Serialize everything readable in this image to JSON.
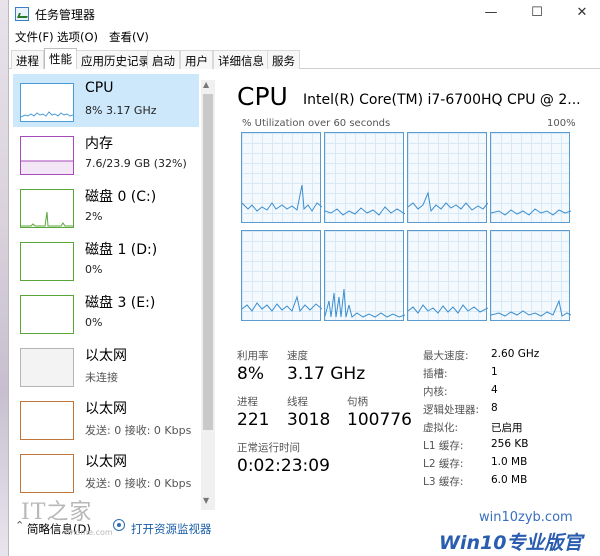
{
  "window": {
    "title": "任务管理器",
    "min": "—",
    "max": "☐",
    "close": "✕"
  },
  "menu": [
    "文件(F)",
    "选项(O)",
    "查看(V)"
  ],
  "tabs": [
    "进程",
    "性能",
    "应用历史记录",
    "启动",
    "用户",
    "详细信息",
    "服务"
  ],
  "active_tab": 1,
  "resources": [
    {
      "name": "CPU",
      "sub": "8% 3.17 GHz",
      "color": "#4a9bd6",
      "selected": true
    },
    {
      "name": "内存",
      "sub": "7.6/23.9 GB (32%)",
      "color": "#a44bb8"
    },
    {
      "name": "磁盘 0 (C:)",
      "sub": "2%",
      "color": "#5aa53a"
    },
    {
      "name": "磁盘 1 (D:)",
      "sub": "0%",
      "color": "#5aa53a"
    },
    {
      "name": "磁盘 3 (E:)",
      "sub": "0%",
      "color": "#5aa53a"
    },
    {
      "name": "以太网",
      "sub": "未连接",
      "color": "#b5b5b5"
    },
    {
      "name": "以太网",
      "sub": "发送: 0 接收: 0 Kbps",
      "color": "#c0763a"
    },
    {
      "name": "以太网",
      "sub": "发送: 0 接收: 0 Kbps",
      "color": "#c0763a"
    }
  ],
  "detail": {
    "heading": "CPU",
    "model": "Intel(R) Core(TM) i7-6700HQ CPU @ 2...",
    "graph_label": "% Utilization over 60 seconds",
    "graph_max": "100%",
    "line_color": "#3b8fd0",
    "stats": {
      "util_label": "利用率",
      "util_value": "8%",
      "speed_label": "速度",
      "speed_value": "3.17 GHz",
      "proc_label": "进程",
      "proc_value": "221",
      "threads_label": "线程",
      "threads_value": "3018",
      "handles_label": "句柄",
      "handles_value": "100776",
      "uptime_label": "正常运行时间",
      "uptime_value": "0:02:23:09"
    },
    "specs": [
      {
        "key": "最大速度:",
        "val": "2.60 GHz"
      },
      {
        "key": "插槽:",
        "val": "1"
      },
      {
        "key": "内核:",
        "val": "4"
      },
      {
        "key": "逻辑处理器:",
        "val": "8"
      },
      {
        "key": "虚拟化:",
        "val": "已启用"
      },
      {
        "key": "L1 缓存:",
        "val": "256 KB"
      },
      {
        "key": "L2 缓存:",
        "val": "1.0 MB"
      },
      {
        "key": "L3 缓存:",
        "val": "6.0 MB"
      }
    ]
  },
  "footer": {
    "summary": "简略信息(D)",
    "resmon": "打开资源监视器"
  },
  "watermarks": {
    "left": "IT之家",
    "left_sub": "ithome.com",
    "right_1": "win10zyb.com",
    "right_2": "Win10专业版官网"
  }
}
